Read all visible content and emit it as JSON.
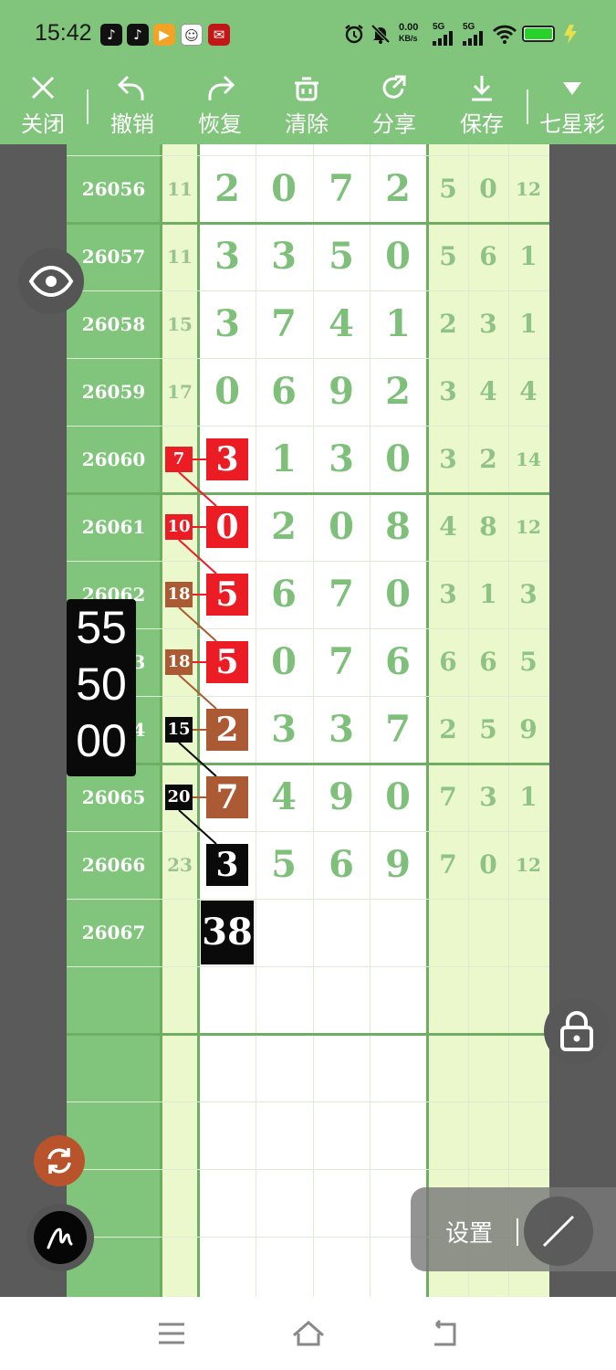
{
  "status_bar": {
    "time": "15:42",
    "net_speed_top": "0.00",
    "net_speed_unit": "KB/s",
    "signal_1": "5G",
    "signal_2": "5G",
    "battery_level": 1.0,
    "app_icons": [
      "tiktok-icon",
      "tiktok-icon",
      "video-app-icon",
      "avatar-app-icon",
      "shop-app-icon"
    ],
    "status_icons": [
      "alarm-icon",
      "mute-icon",
      "wifi-icon",
      "battery-icon",
      "charging-icon"
    ]
  },
  "toolbar": {
    "items": [
      {
        "label": "关闭",
        "icon": "close-icon"
      },
      {
        "label": "撤销",
        "icon": "undo-icon"
      },
      {
        "label": "恢复",
        "icon": "redo-icon"
      },
      {
        "label": "清除",
        "icon": "trash-icon"
      },
      {
        "label": "分享",
        "icon": "share-icon"
      },
      {
        "label": "保存",
        "icon": "download-icon"
      },
      {
        "label": "七星彩",
        "icon": "triangle-down-icon"
      }
    ]
  },
  "rows": [
    {
      "period": "26056",
      "sum": "11",
      "digits": [
        "2",
        "0",
        "7",
        "2"
      ],
      "tail": [
        "5",
        "0",
        "12"
      ]
    },
    {
      "period": "26057",
      "sum": "11",
      "digits": [
        "3",
        "3",
        "5",
        "0"
      ],
      "tail": [
        "5",
        "6",
        "1"
      ]
    },
    {
      "period": "26058",
      "sum": "15",
      "digits": [
        "3",
        "7",
        "4",
        "1"
      ],
      "tail": [
        "2",
        "3",
        "1"
      ]
    },
    {
      "period": "26059",
      "sum": "17",
      "digits": [
        "0",
        "6",
        "9",
        "2"
      ],
      "tail": [
        "3",
        "4",
        "4"
      ]
    },
    {
      "period": "26060",
      "sum": "7",
      "digits": [
        "3",
        "1",
        "3",
        "0"
      ],
      "tail": [
        "3",
        "2",
        "14"
      ]
    },
    {
      "period": "26061",
      "sum": "10",
      "digits": [
        "0",
        "2",
        "0",
        "8"
      ],
      "tail": [
        "4",
        "8",
        "12"
      ]
    },
    {
      "period": "26062",
      "sum": "18",
      "digits": [
        "5",
        "6",
        "7",
        "0"
      ],
      "tail": [
        "3",
        "1",
        "3"
      ]
    },
    {
      "period": "26063",
      "sum": "18",
      "digits": [
        "5",
        "0",
        "7",
        "6"
      ],
      "tail": [
        "6",
        "6",
        "5"
      ]
    },
    {
      "period": "26064",
      "sum": "15",
      "digits": [
        "2",
        "3",
        "3",
        "7"
      ],
      "tail": [
        "2",
        "5",
        "9"
      ]
    },
    {
      "period": "26065",
      "sum": "20",
      "digits": [
        "7",
        "4",
        "9",
        "0"
      ],
      "tail": [
        "7",
        "3",
        "1"
      ]
    },
    {
      "period": "26066",
      "sum": "23",
      "digits": [
        "3",
        "5",
        "6",
        "9"
      ],
      "tail": [
        "7",
        "0",
        "12"
      ]
    },
    {
      "period": "26067",
      "sum": "",
      "digits": [
        "38",
        "",
        "",
        ""
      ],
      "tail": [
        "",
        "",
        ""
      ]
    }
  ],
  "highlights": {
    "sum_colors": {
      "4": "red",
      "5": "red",
      "6": "brown",
      "7": "brown",
      "8": "black",
      "9": "black"
    },
    "digit_colors": {
      "4": "red",
      "5": "red",
      "6": "red",
      "7": "red",
      "8": "brown",
      "9": "brown",
      "10": "black",
      "11": "black"
    }
  },
  "colors": {
    "header_green": "#80c57b",
    "red": "#ec1c24",
    "brown": "#ab5a33",
    "black": "#0a0a0a",
    "digit_green": "#7ec07a"
  },
  "side_panel": {
    "values": [
      "55",
      "50",
      "00"
    ]
  },
  "settings": {
    "label": "设置"
  },
  "floating_icons": [
    "eye-icon",
    "lock-icon",
    "refresh-icon",
    "pen-icon",
    "line-tool-icon"
  ],
  "navbar": {
    "icons": [
      "menu-icon",
      "home-icon",
      "back-icon"
    ]
  }
}
